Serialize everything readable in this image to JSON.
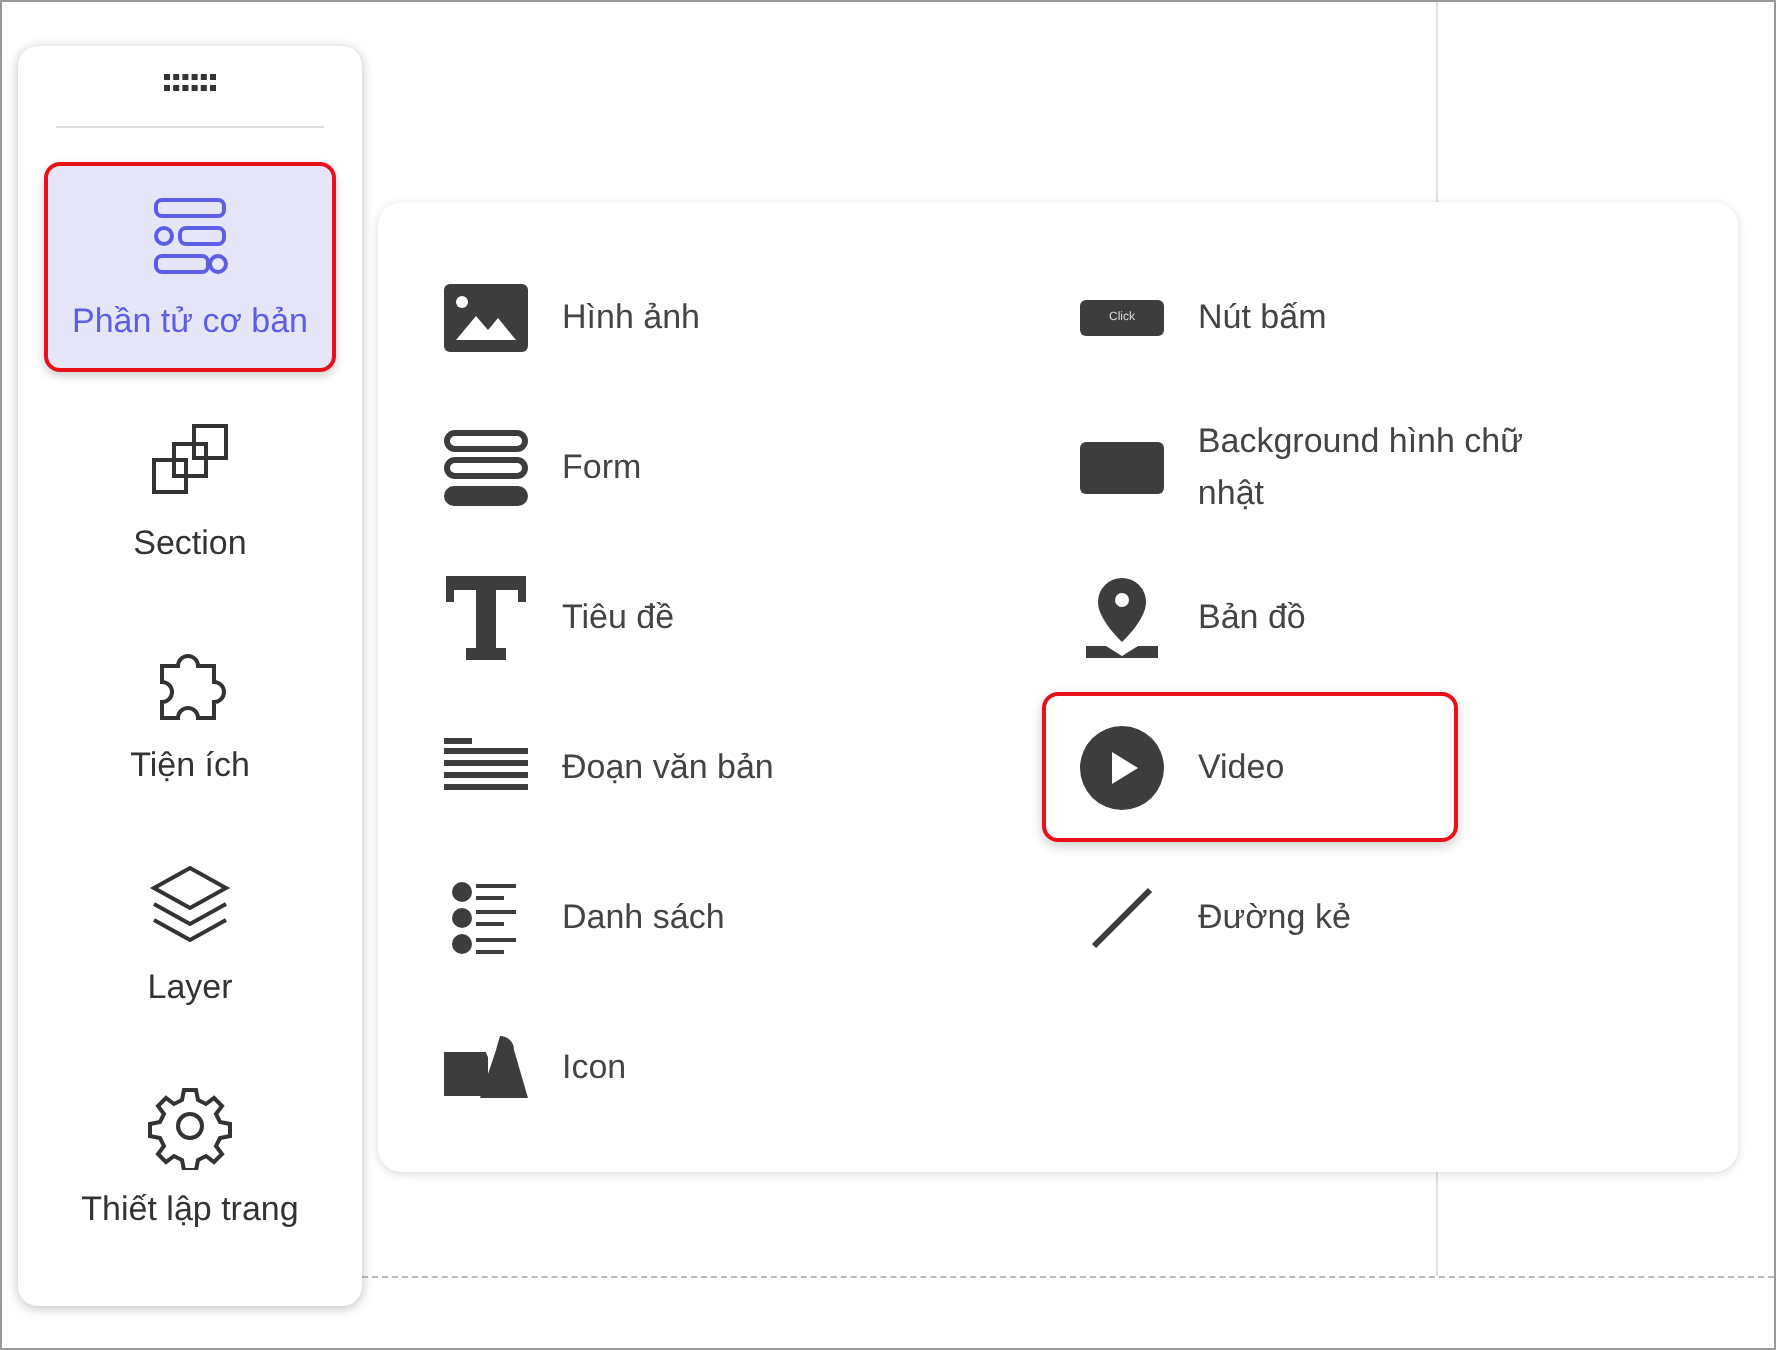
{
  "sidebar": {
    "items": [
      {
        "label": "Phần tử cơ bản",
        "kind": "elements",
        "selected": true
      },
      {
        "label": "Section",
        "kind": "section",
        "selected": false
      },
      {
        "label": "Tiện ích",
        "kind": "puzzle",
        "selected": false
      },
      {
        "label": "Layer",
        "kind": "layers",
        "selected": false
      },
      {
        "label": "Thiết lập trang",
        "kind": "gear",
        "selected": false
      }
    ]
  },
  "panel": {
    "columns": [
      [
        {
          "label": "Hình ảnh",
          "kind": "image",
          "highlighted": false
        },
        {
          "label": "Form",
          "kind": "form",
          "highlighted": false
        },
        {
          "label": "Tiêu đề",
          "kind": "title",
          "highlighted": false
        },
        {
          "label": "Đoạn văn bản",
          "kind": "paragraph",
          "highlighted": false
        },
        {
          "label": "Danh sách",
          "kind": "list",
          "highlighted": false
        },
        {
          "label": "Icon",
          "kind": "shapes",
          "highlighted": false
        }
      ],
      [
        {
          "label": "Nút bấm",
          "kind": "button",
          "icon_text": "Click",
          "highlighted": false
        },
        {
          "label": "Background hình chữ nhật",
          "kind": "rect",
          "highlighted": false
        },
        {
          "label": "Bản đồ",
          "kind": "map",
          "highlighted": false
        },
        {
          "label": "Video",
          "kind": "video",
          "highlighted": true
        },
        {
          "label": "Đường kẻ",
          "kind": "line",
          "highlighted": false
        }
      ]
    ]
  }
}
